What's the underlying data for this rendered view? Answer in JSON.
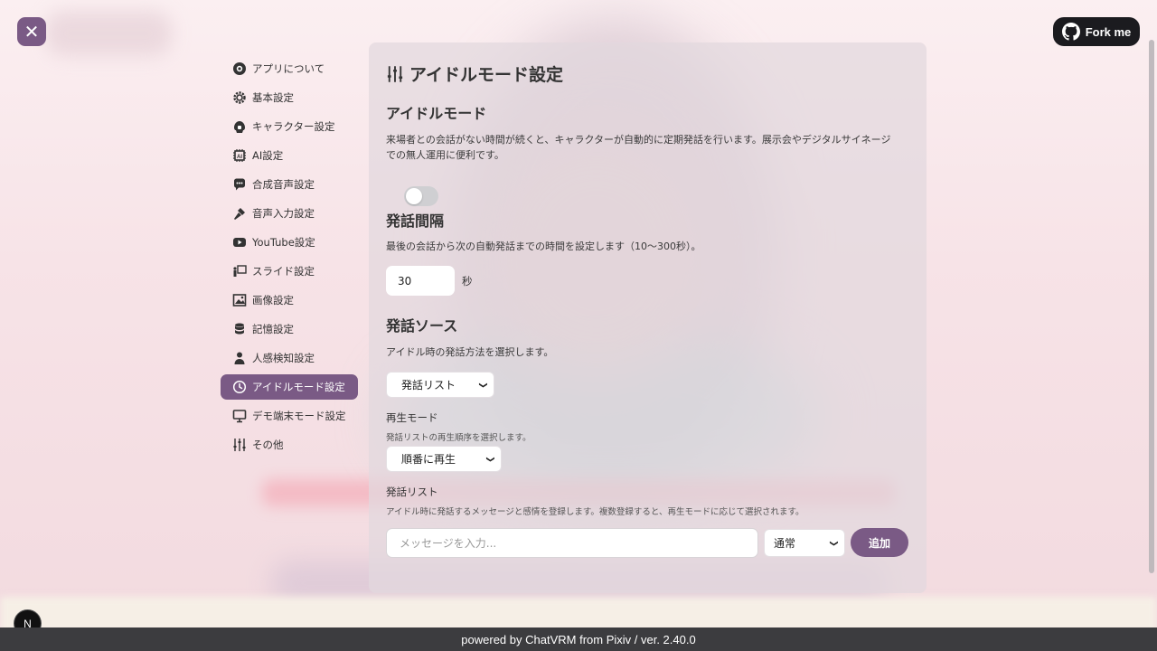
{
  "header": {
    "close_icon": "x-icon",
    "fork_label": "Fork me"
  },
  "sidebar": {
    "items": [
      {
        "label": "アプリについて",
        "icon": "info-icon",
        "active": false
      },
      {
        "label": "基本設定",
        "icon": "gear-icon",
        "active": false
      },
      {
        "label": "キャラクター設定",
        "icon": "character-icon",
        "active": false
      },
      {
        "label": "AI設定",
        "icon": "ai-chip-icon",
        "active": false
      },
      {
        "label": "合成音声設定",
        "icon": "speech-bubble-icon",
        "active": false
      },
      {
        "label": "音声入力設定",
        "icon": "microphone-icon",
        "active": false
      },
      {
        "label": "YouTube設定",
        "icon": "youtube-icon",
        "active": false
      },
      {
        "label": "スライド設定",
        "icon": "slide-icon",
        "active": false
      },
      {
        "label": "画像設定",
        "icon": "image-icon",
        "active": false
      },
      {
        "label": "記憶設定",
        "icon": "database-icon",
        "active": false
      },
      {
        "label": "人感検知設定",
        "icon": "person-icon",
        "active": false
      },
      {
        "label": "アイドルモード設定",
        "icon": "clock-icon",
        "active": true
      },
      {
        "label": "デモ端末モード設定",
        "icon": "monitor-icon",
        "active": false
      },
      {
        "label": "その他",
        "icon": "sliders-icon",
        "active": false
      }
    ]
  },
  "panel": {
    "title": "アイドルモード設定",
    "idle": {
      "heading": "アイドルモード",
      "desc1": "来場者との会話がない時間が続くと、キャラクターが自動的に定期発話を行います。展示会やデジタルサイネージ",
      "desc2": "での無人運用に便利です。",
      "enabled": false
    },
    "interval": {
      "heading": "発話間隔",
      "desc": "最後の会話から次の自動発話までの時間を設定します（10〜300秒）。",
      "value": "30",
      "unit": "秒"
    },
    "source": {
      "heading": "発話ソース",
      "desc": "アイドル時の発話方法を選択します。",
      "selected": "発話リスト"
    },
    "playback": {
      "label": "再生モード",
      "desc": "発話リストの再生順序を選択します。",
      "selected": "順番に再生"
    },
    "list": {
      "label": "発話リスト",
      "desc": "アイドル時に発話するメッセージと感情を登録します。複数登録すると、再生モードに応じて選択されます。",
      "placeholder": "メッセージを入力...",
      "emotion": "通常",
      "add_label": "追加"
    }
  },
  "badge": "N",
  "footer": "powered by ChatVRM from Pixiv / ver. 2.40.0",
  "colors": {
    "accent": "#7a5a85",
    "footer_bg": "#3c3c3f",
    "fork_bg": "#1b1b1f"
  }
}
